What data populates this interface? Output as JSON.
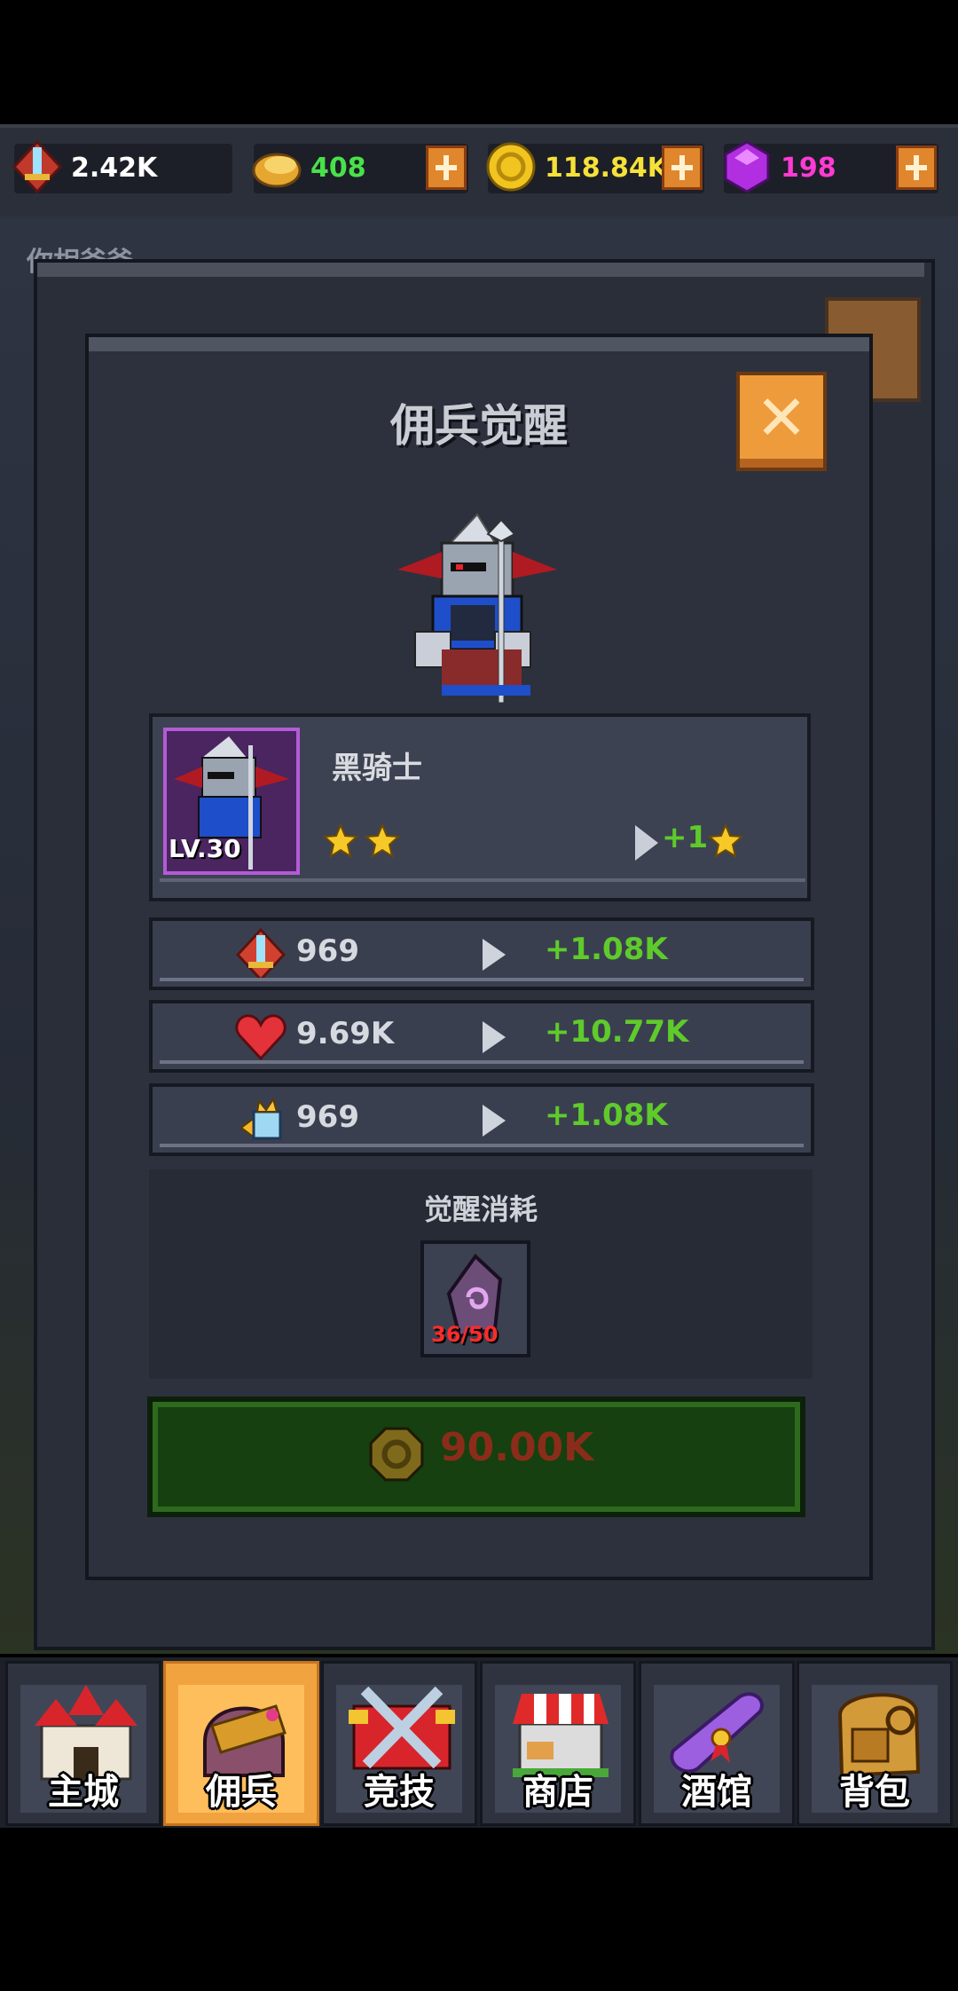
{
  "resources": [
    {
      "icon": "attack-gem-icon",
      "value": "2.42K",
      "color": "#ffffff"
    },
    {
      "icon": "bread-icon",
      "value": "408",
      "color": "#49e14a"
    },
    {
      "icon": "gold-coin-icon",
      "value": "118.84K",
      "color": "#f5e13a"
    },
    {
      "icon": "purple-gem-icon",
      "value": "198",
      "color": "#ff3ad4"
    }
  ],
  "background": {
    "title": "你相爸爸"
  },
  "dialog": {
    "title": "佣兵觉醒",
    "hero": {
      "name": "黑骑士",
      "level": "LV.30",
      "stars": 2,
      "star_bonus": "+1"
    },
    "stats": [
      {
        "icon": "attack-icon",
        "current": "969",
        "bonus": "+1.08K"
      },
      {
        "icon": "health-heart-icon",
        "current": "9.69K",
        "bonus": "+10.77K"
      },
      {
        "icon": "speed-fist-icon",
        "current": "969",
        "bonus": "+1.08K"
      }
    ],
    "cost": {
      "title": "觉醒消耗",
      "item_icon": "awaken-stone-icon",
      "count": "36/50"
    },
    "awaken_price": "90.00K"
  },
  "nav": [
    {
      "label": "主城",
      "icon": "castle-icon",
      "active": false
    },
    {
      "label": "佣兵",
      "icon": "mercenary-helmet-icon",
      "active": true
    },
    {
      "label": "竞技",
      "icon": "crossed-swords-icon",
      "active": false
    },
    {
      "label": "商店",
      "icon": "shop-icon",
      "active": false
    },
    {
      "label": "酒馆",
      "icon": "tavern-scroll-icon",
      "active": false
    },
    {
      "label": "背包",
      "icon": "backpack-icon",
      "active": false
    }
  ]
}
